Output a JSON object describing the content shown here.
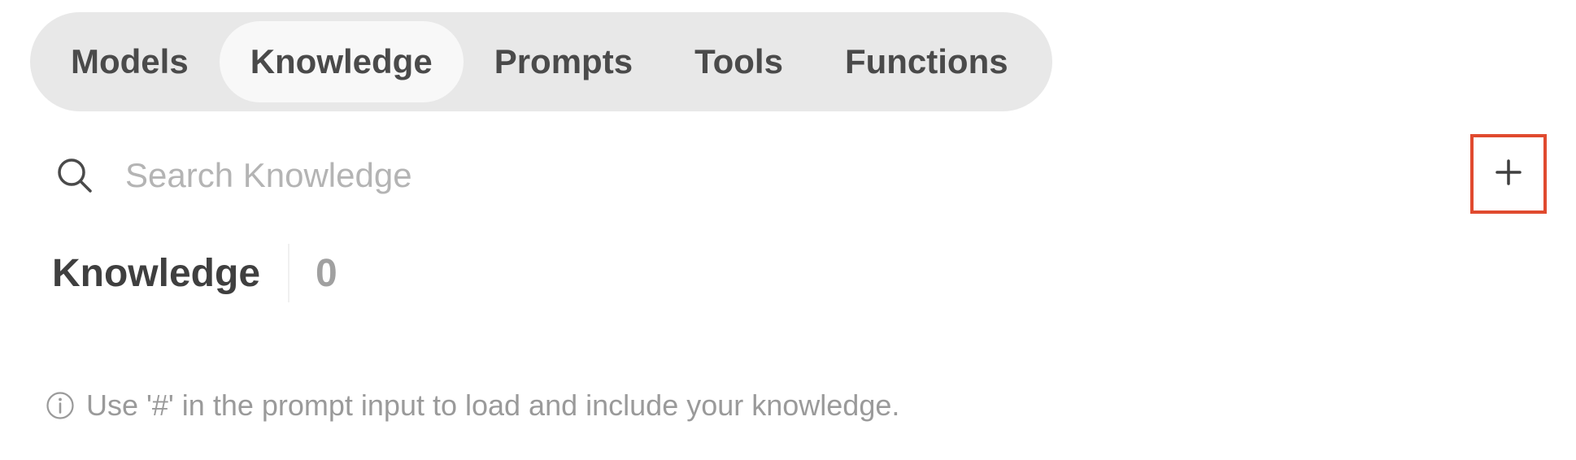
{
  "tabs": [
    {
      "label": "Models",
      "active": false
    },
    {
      "label": "Knowledge",
      "active": true
    },
    {
      "label": "Prompts",
      "active": false
    },
    {
      "label": "Tools",
      "active": false
    },
    {
      "label": "Functions",
      "active": false
    }
  ],
  "search": {
    "icon": "search-icon",
    "placeholder": "Search Knowledge",
    "value": ""
  },
  "add_button": {
    "icon": "plus-icon",
    "highlight_color": "#e04a2f"
  },
  "heading": {
    "title": "Knowledge",
    "count": "0"
  },
  "note": {
    "icon": "info-icon",
    "text": "Use '#' in the prompt input to load and include your knowledge."
  }
}
